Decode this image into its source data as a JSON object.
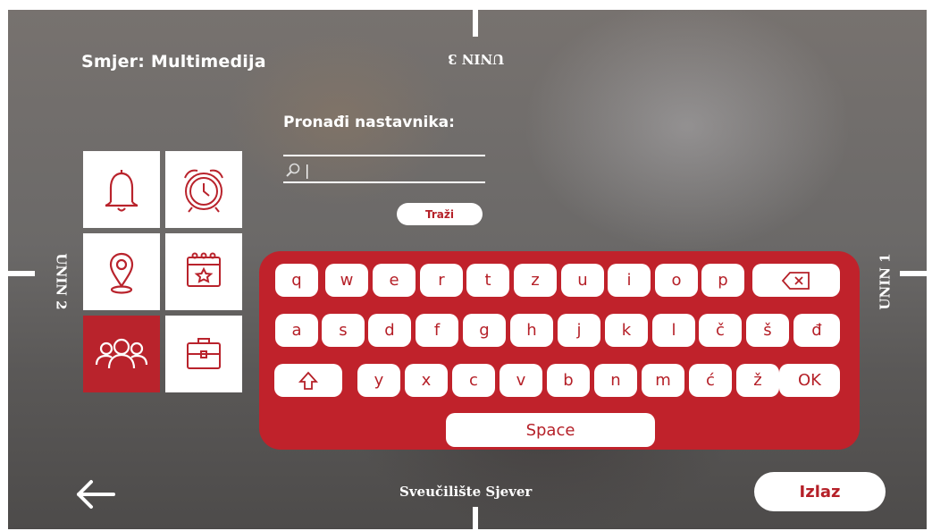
{
  "header": {
    "title": "Smjer: Multimedija"
  },
  "labels": {
    "top": "UNIN 3",
    "left": "UNIN 2",
    "right": "UNIN 1"
  },
  "search": {
    "title": "Pronađi nastavnika:",
    "value": "|",
    "button": "Traži"
  },
  "tiles": [
    {
      "icon": "bell-icon",
      "active": false
    },
    {
      "icon": "alarm-clock-icon",
      "active": false
    },
    {
      "icon": "location-pin-icon",
      "active": false
    },
    {
      "icon": "calendar-star-icon",
      "active": false
    },
    {
      "icon": "people-group-icon",
      "active": true
    },
    {
      "icon": "briefcase-icon",
      "active": false
    }
  ],
  "keyboard": {
    "row1": [
      "q",
      "w",
      "e",
      "r",
      "t",
      "z",
      "u",
      "i",
      "o",
      "p"
    ],
    "row2": [
      "a",
      "s",
      "d",
      "f",
      "g",
      "h",
      "j",
      "k",
      "l",
      "č",
      "š",
      "đ"
    ],
    "row3": [
      "y",
      "x",
      "c",
      "v",
      "b",
      "n",
      "m",
      "ć",
      "ž"
    ],
    "backspace_icon": "backspace-icon",
    "shift_icon": "shift-icon",
    "ok": "OK",
    "space": "Space"
  },
  "footer": {
    "text": "Sveučilište Sjever",
    "exit": "Izlaz",
    "back_icon": "arrow-left-icon"
  },
  "colors": {
    "accent": "#c0222b",
    "text_on_dark": "#ffffff"
  }
}
